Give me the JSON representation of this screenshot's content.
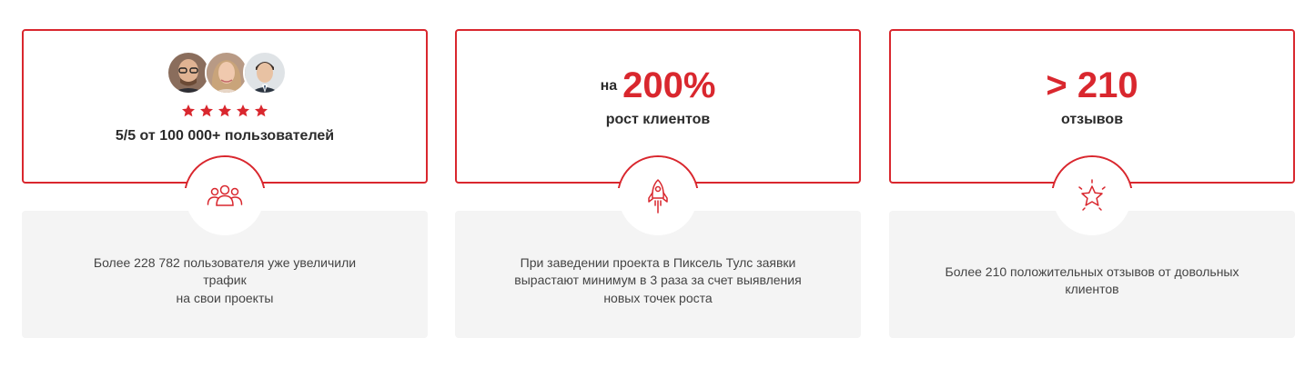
{
  "accent_color": "#d9272e",
  "cards": [
    {
      "rating_stars": 5,
      "rating_text": "5/5 от 100 000+ пользователей",
      "avatars": [
        "man-glasses-avatar",
        "woman-blonde-avatar",
        "man-suit-avatar"
      ],
      "icon": "users-group-icon",
      "description": "Более 228 782 пользователя уже увеличили трафик\nна свои проекты"
    },
    {
      "prefix": "на",
      "value": "200%",
      "label": "рост клиентов",
      "icon": "rocket-icon",
      "description": "При заведении проекта в Пиксель Тулс заявки\nвырастают минимум в 3 раза за счет выявления\nновых точек роста"
    },
    {
      "value": "> 210",
      "label": "отзывов",
      "icon": "star-outline-icon",
      "description": "Более 210 положительных отзывов от довольных\nклиентов"
    }
  ]
}
